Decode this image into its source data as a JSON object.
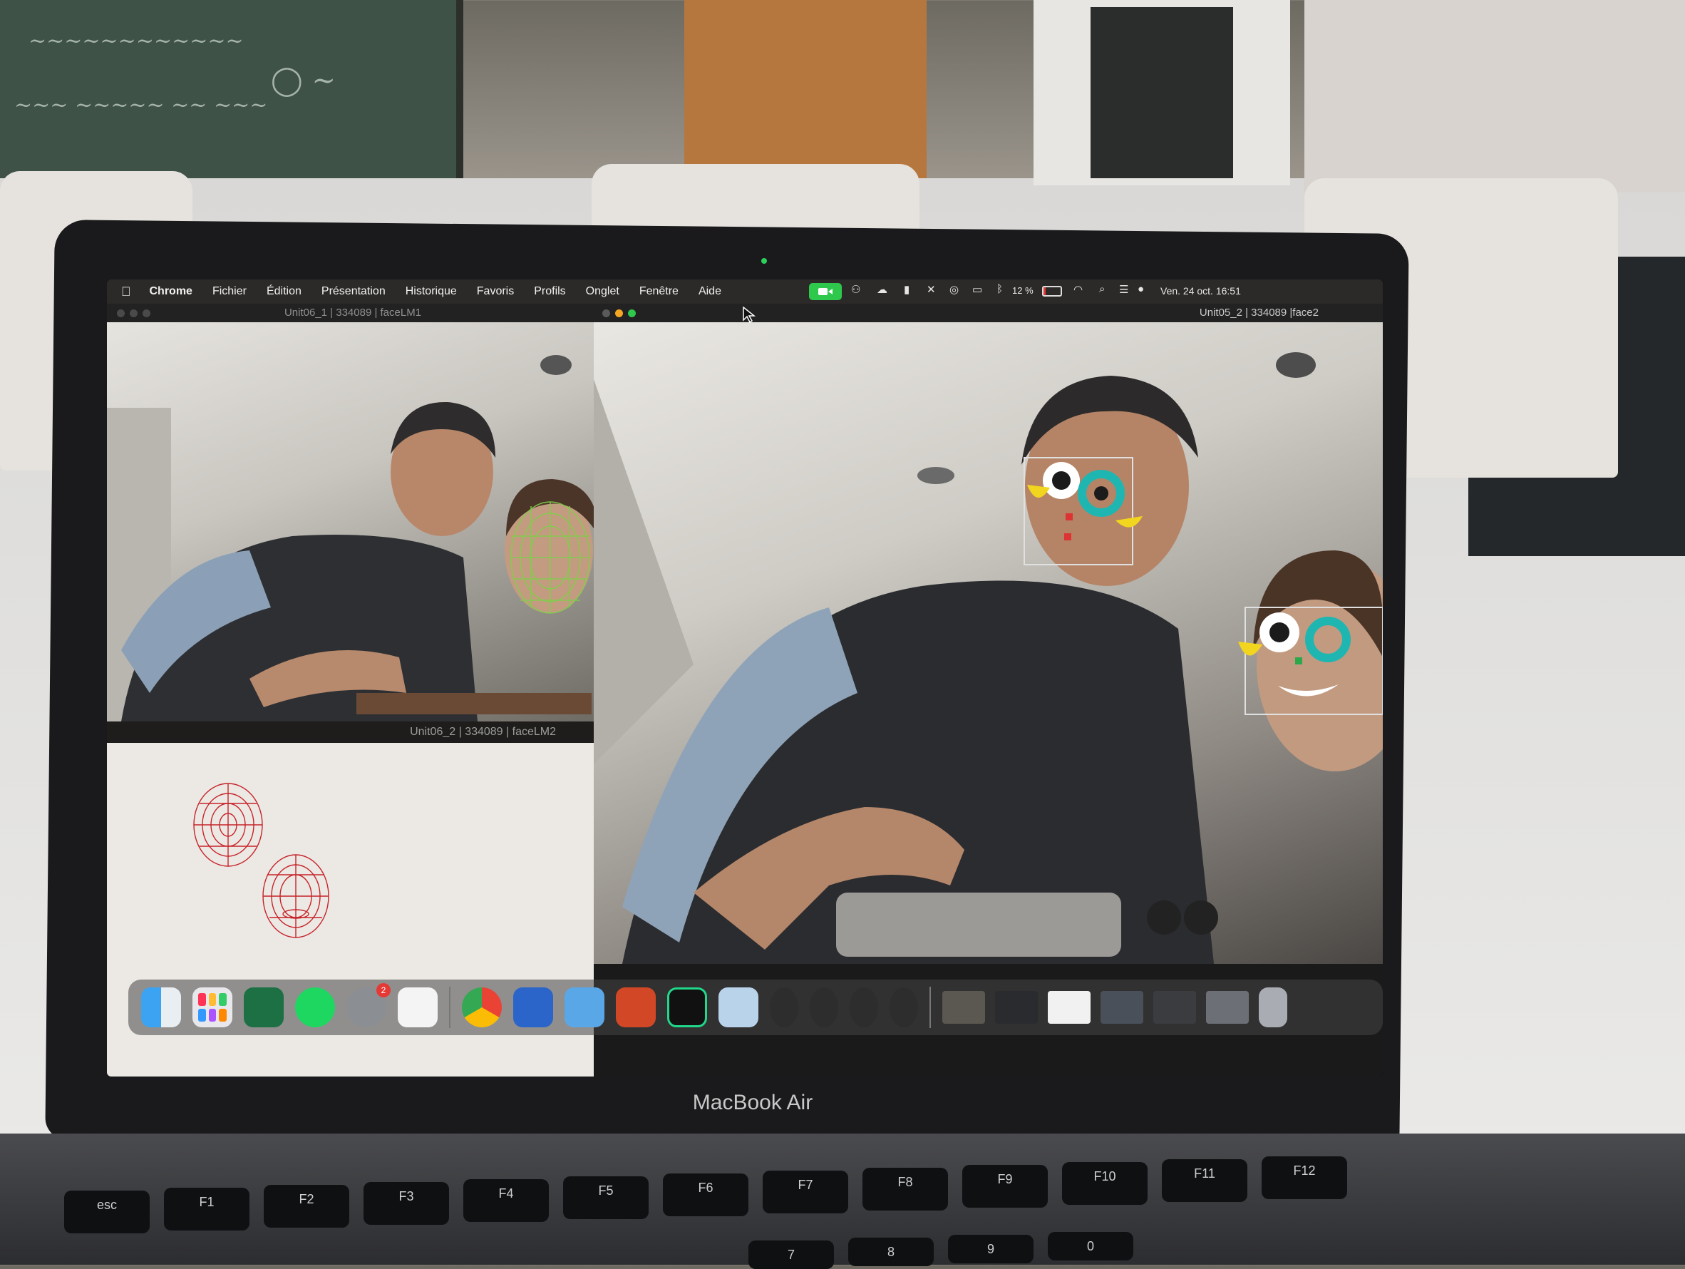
{
  "menubar": {
    "apple_glyph": "",
    "app_name": "Chrome",
    "items": [
      "Fichier",
      "Édition",
      "Présentation",
      "Historique",
      "Favoris",
      "Profils",
      "Onglet",
      "Fenêtre",
      "Aide"
    ],
    "battery": "12 %",
    "datetime": "Ven. 24 oct.  16:51"
  },
  "window_left": {
    "title": "Unit06_1 | 334089 | faceLM1",
    "camera_label": "Unit06_2 | 334089 | faceLM2"
  },
  "window_right": {
    "title": "Unit05_2 | 334089 |face2"
  },
  "dock": {
    "apps": [
      "finder-icon",
      "launchpad-icon",
      "excel-icon",
      "spotify-icon",
      "system-settings-icon",
      "freeform-icon",
      "chrome-icon",
      "word-icon",
      "paw-icon",
      "powerpoint-icon",
      "pycharm-icon",
      "preview-icon",
      "script-icon",
      "script-icon",
      "script-icon",
      "script-icon"
    ],
    "settings_badge": "2"
  },
  "laptop": {
    "brand": "MacBook Air"
  },
  "keyboard": {
    "keys": [
      "esc",
      "F1",
      "F2",
      "F3",
      "F4",
      "F5",
      "F6",
      "F7",
      "F8",
      "F9",
      "F10",
      "F11",
      "F12"
    ],
    "number_keys": [
      "7",
      "8",
      "9",
      "0"
    ]
  },
  "colors": {
    "eye_cyan": "#1fb6b1",
    "eye_yellow": "#f2d51f",
    "mesh_green": "#7fd04a",
    "mesh_red": "#c7232a",
    "facetime_green": "#2ec84d"
  }
}
